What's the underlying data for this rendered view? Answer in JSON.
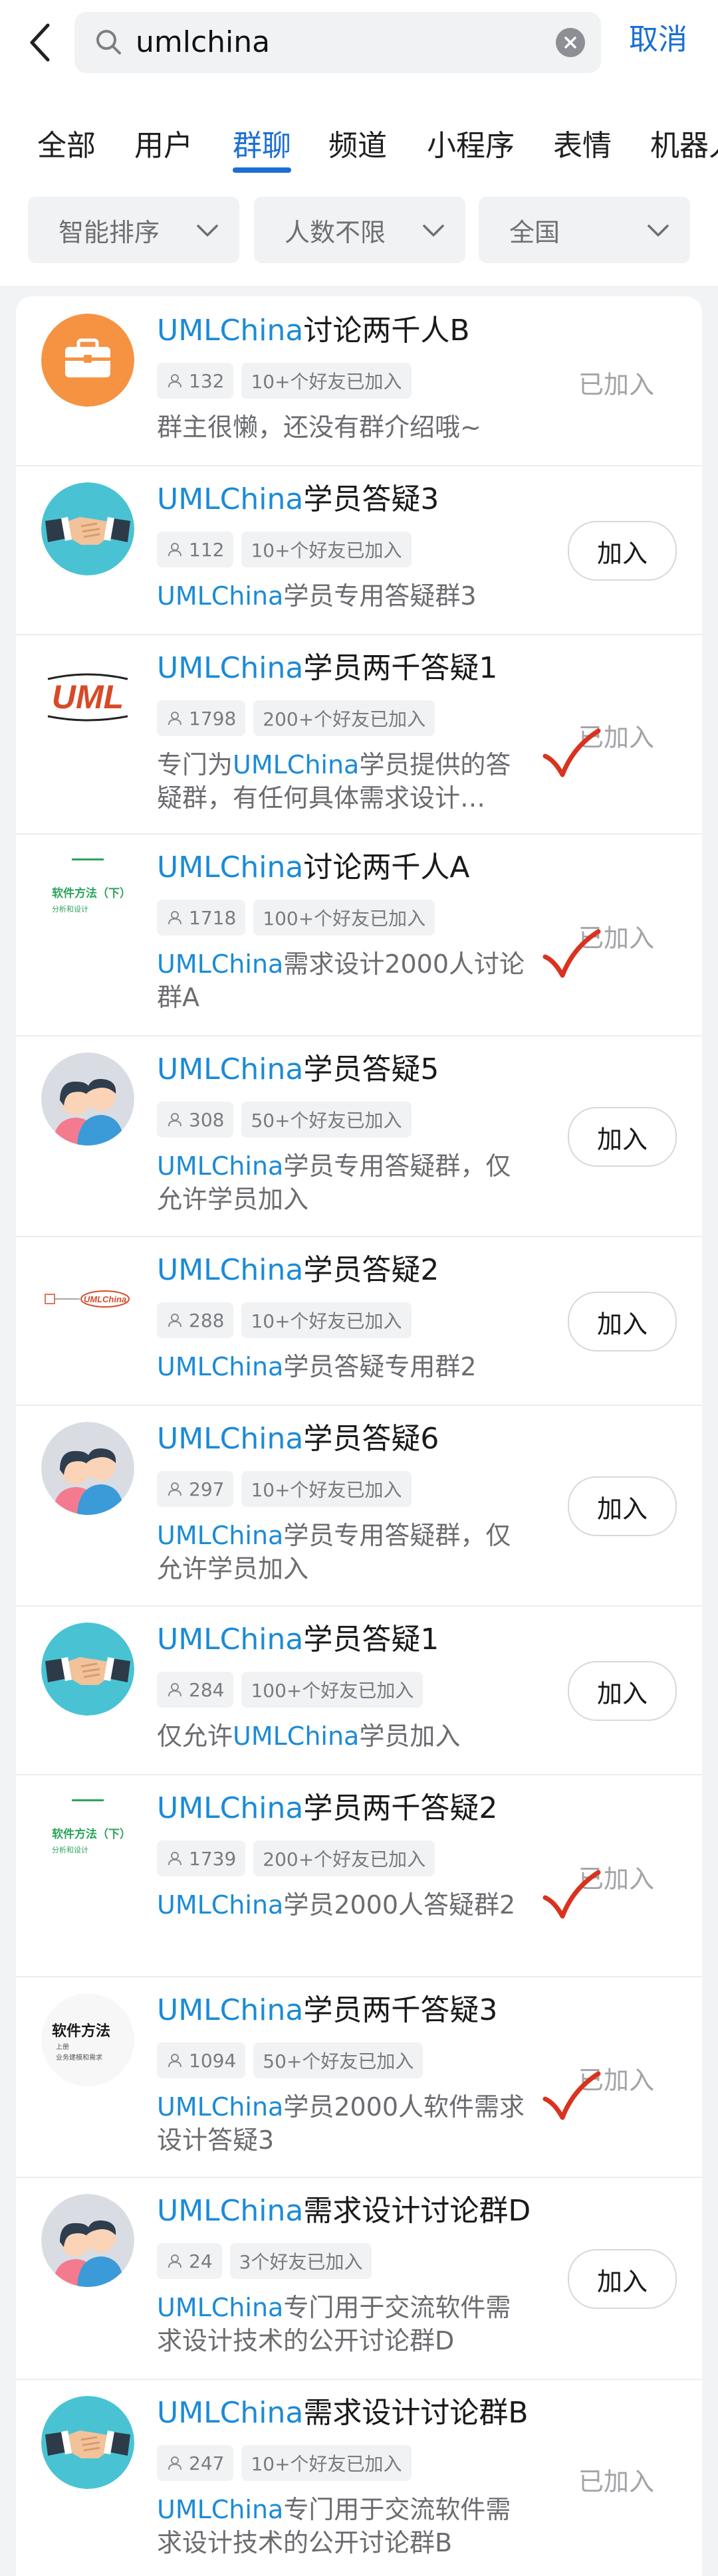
{
  "search": {
    "query": "umlchina",
    "cancel": "取消"
  },
  "tabs": [
    "全部",
    "用户",
    "群聊",
    "频道",
    "小程序",
    "表情",
    "机器人"
  ],
  "filters": [
    "智能排序",
    "人数不限",
    "全国"
  ],
  "join_label": "加入",
  "joined_label": "已加入",
  "colors": {
    "accent": "#1b6fd3",
    "highlight": "#1b8bd6",
    "check": "#d9331f"
  },
  "groups": [
    {
      "pre": "",
      "hl": "UMLChina",
      "rest": "讨论两千人B",
      "count": "132",
      "friends": "10+个好友已加入",
      "desc": [
        {
          "t": "群主很懒，还没有群介绍哦~",
          "h": false
        }
      ],
      "status": "joined",
      "checked": false,
      "avatar": "briefcase-icon"
    },
    {
      "pre": "",
      "hl": "UMLChina",
      "rest": "学员答疑3",
      "count": "112",
      "friends": "10+个好友已加入",
      "desc": [
        {
          "t": "UMLChina",
          "h": true
        },
        {
          "t": "学员专用答疑群3",
          "h": false
        }
      ],
      "status": "join",
      "checked": false,
      "avatar": "handshake-icon"
    },
    {
      "pre": "",
      "hl": "UMLChina",
      "rest": "学员两千答疑1",
      "count": "1798",
      "friends": "200+个好友已加入",
      "desc": [
        {
          "t": "专门为",
          "h": false
        },
        {
          "t": "UMLChina",
          "h": true
        },
        {
          "t": "学员提供的答疑群，有任何具体需求设计…",
          "h": false
        }
      ],
      "status": "joined",
      "checked": true,
      "avatar": "uml-logo"
    },
    {
      "pre": "",
      "hl": "UMLChina",
      "rest": "讨论两千人A",
      "count": "1718",
      "friends": "100+个好友已加入",
      "desc": [
        {
          "t": "UMLChina",
          "h": true
        },
        {
          "t": "需求设计2000人讨论群A",
          "h": false
        }
      ],
      "status": "joined",
      "checked": true,
      "avatar": "book-cover-green"
    },
    {
      "pre": "",
      "hl": "UMLChina",
      "rest": "学员答疑5",
      "count": "308",
      "friends": "50+个好友已加入",
      "desc": [
        {
          "t": "UMLChina",
          "h": true
        },
        {
          "t": "学员专用答疑群，仅允许学员加入",
          "h": false
        }
      ],
      "status": "join",
      "checked": false,
      "avatar": "couple-icon"
    },
    {
      "pre": "",
      "hl": "UMLChina",
      "rest": "学员答疑2",
      "count": "288",
      "friends": "10+个好友已加入",
      "desc": [
        {
          "t": "UMLChina",
          "h": true
        },
        {
          "t": "学员答疑专用群2",
          "h": false
        }
      ],
      "status": "join",
      "checked": false,
      "avatar": "diagram-logo"
    },
    {
      "pre": "",
      "hl": "UMLChina",
      "rest": "学员答疑6",
      "count": "297",
      "friends": "10+个好友已加入",
      "desc": [
        {
          "t": "UMLChina",
          "h": true
        },
        {
          "t": "学员专用答疑群，仅允许学员加入",
          "h": false
        }
      ],
      "status": "join",
      "checked": false,
      "avatar": "couple-icon"
    },
    {
      "pre": "",
      "hl": "UMLChina",
      "rest": "学员答疑1",
      "count": "284",
      "friends": "100+个好友已加入",
      "desc": [
        {
          "t": "仅允许",
          "h": false
        },
        {
          "t": "UMLChina",
          "h": true
        },
        {
          "t": "学员加入",
          "h": false
        }
      ],
      "status": "join",
      "checked": false,
      "avatar": "handshake-icon"
    },
    {
      "pre": "",
      "hl": "UMLChina",
      "rest": "学员两千答疑2",
      "count": "1739",
      "friends": "200+个好友已加入",
      "desc": [
        {
          "t": "UMLChina",
          "h": true
        },
        {
          "t": "学员2000人答疑群2",
          "h": false
        }
      ],
      "status": "joined",
      "checked": true,
      "avatar": "book-cover-green"
    },
    {
      "pre": "",
      "hl": "UMLChina",
      "rest": "学员两千答疑3",
      "count": "1094",
      "friends": "50+个好友已加入",
      "desc": [
        {
          "t": "UMLChina",
          "h": true
        },
        {
          "t": "学员2000人软件需求设计答疑3",
          "h": false
        }
      ],
      "status": "joined",
      "checked": true,
      "avatar": "book-cover-dark"
    },
    {
      "pre": "",
      "hl": "UMLChina",
      "rest": "需求设计讨论群D",
      "count": "24",
      "friends": "3个好友已加入",
      "desc": [
        {
          "t": "UMLChina",
          "h": true
        },
        {
          "t": "专门用于交流软件需求设计技术的公开讨论群D",
          "h": false
        }
      ],
      "status": "join",
      "checked": false,
      "avatar": "couple-icon"
    },
    {
      "pre": "",
      "hl": "UMLChina",
      "rest": "需求设计讨论群B",
      "count": "247",
      "friends": "10+个好友已加入",
      "desc": [
        {
          "t": "UMLChina",
          "h": true
        },
        {
          "t": "专门用于交流软件需求设计技术的公开讨论群B",
          "h": false
        }
      ],
      "status": "joined",
      "checked": false,
      "avatar": "handshake-icon"
    }
  ],
  "avatar_text": {
    "uml": "UML",
    "book_green_title": "软件方法（下）",
    "book_green_sub": "分析和设计",
    "book_dark_title": "软件方法",
    "book_dark_sub1": "上册",
    "book_dark_sub2": "业务建模和需求",
    "diagram_label": "UMLChina"
  }
}
